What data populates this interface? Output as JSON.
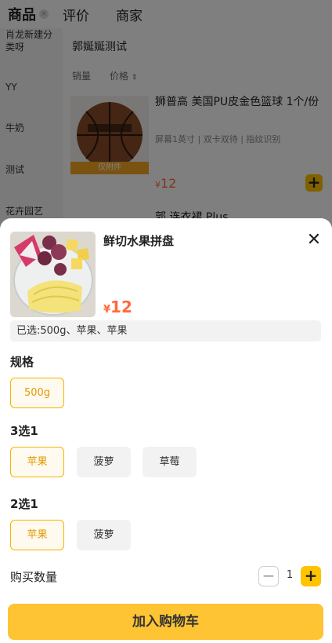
{
  "tabs": [
    {
      "label": "商品"
    },
    {
      "label": "评价"
    },
    {
      "label": "商家"
    }
  ],
  "sidebar": {
    "items": [
      {
        "label": "肖龙新建分类呀"
      },
      {
        "label": "YY"
      },
      {
        "label": "牛奶"
      },
      {
        "label": "测试"
      },
      {
        "label": "花卉园艺"
      }
    ]
  },
  "content": {
    "category_title": "郭娫娫测试",
    "sort": {
      "sales": "销量",
      "price": "价格"
    },
    "products": [
      {
        "name": "狮普高 美国PU皮金色篮球 1个/份",
        "tags": "屏幕1英寸 | 双卡双待 | 指纹识别",
        "badge": "仅附件",
        "currency": "¥",
        "price": "12"
      },
      {
        "name": "郭 连衣裙 Plus"
      }
    ]
  },
  "sheet": {
    "title": "鲜切水果拼盘",
    "currency": "¥",
    "price": "12",
    "selected": "已选:500g、苹果、苹果",
    "groups": [
      {
        "title": "规格",
        "options": [
          {
            "label": "500g",
            "selected": true
          }
        ]
      },
      {
        "title": "3选1",
        "options": [
          {
            "label": "苹果",
            "selected": true
          },
          {
            "label": "菠萝",
            "selected": false
          },
          {
            "label": "草莓",
            "selected": false
          }
        ]
      },
      {
        "title": "2选1",
        "options": [
          {
            "label": "苹果",
            "selected": true
          },
          {
            "label": "菠萝",
            "selected": false
          }
        ]
      }
    ],
    "quantity_label": "购买数量",
    "quantity": "1",
    "add_to_cart": "加入购物车"
  },
  "colors": {
    "accent_yellow": "#ffc300",
    "price_orange": "#ff6a3d",
    "selected_border": "#f5b300"
  }
}
